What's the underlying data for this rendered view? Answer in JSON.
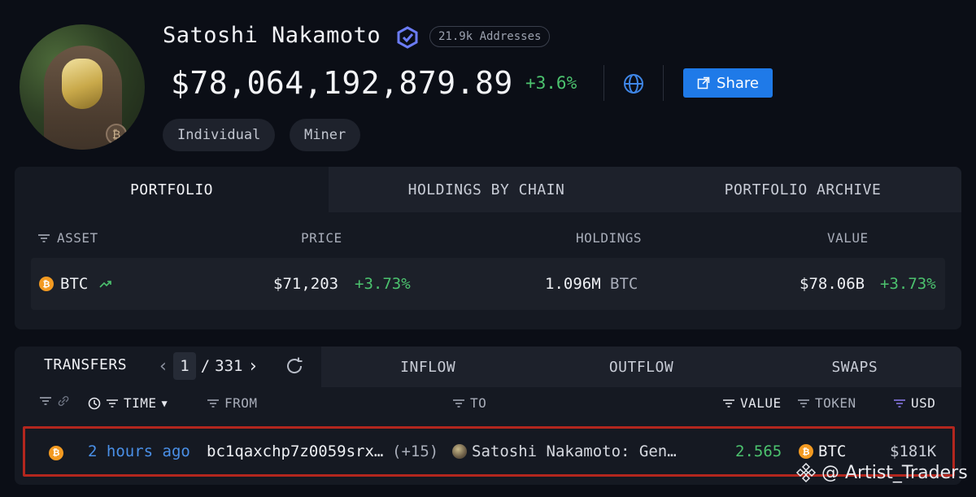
{
  "profile": {
    "name": "Satoshi Nakamoto",
    "addresses_badge": "21.9k Addresses",
    "total_value": "$78,064,192,879.89",
    "total_change": "+3.6%",
    "share_label": "Share",
    "tags": [
      "Individual",
      "Miner"
    ]
  },
  "portfolio": {
    "tabs": [
      "PORTFOLIO",
      "HOLDINGS BY CHAIN",
      "PORTFOLIO ARCHIVE"
    ],
    "columns": {
      "asset": "ASSET",
      "price": "PRICE",
      "holdings": "HOLDINGS",
      "value": "VALUE"
    },
    "row": {
      "asset": "BTC",
      "price": "$71,203",
      "price_change": "+3.73%",
      "holdings_amount": "1.096M",
      "holdings_unit": "BTC",
      "value": "$78.06B",
      "value_change": "+3.73%"
    }
  },
  "transfers": {
    "title": "TRANSFERS",
    "page_current": "1",
    "page_sep": "/",
    "page_total": "331",
    "tabs": [
      "INFLOW",
      "OUTFLOW",
      "SWAPS"
    ],
    "columns": {
      "time": "TIME",
      "from": "FROM",
      "to": "TO",
      "value": "VALUE",
      "token": "TOKEN",
      "usd": "USD"
    },
    "row": {
      "time": "2 hours ago",
      "from": "bc1qaxchp7z0059srx…",
      "from_extra": "(+15)",
      "to": "Satoshi Nakamoto: Gen…",
      "value": "2.565",
      "token": "BTC",
      "usd": "$181K"
    }
  },
  "watermark": "@ Artist_Traders",
  "colors": {
    "accent": "#1f7ae8",
    "positive": "#4cc26e",
    "btc": "#f39a21",
    "highlight": "#b3261e"
  }
}
